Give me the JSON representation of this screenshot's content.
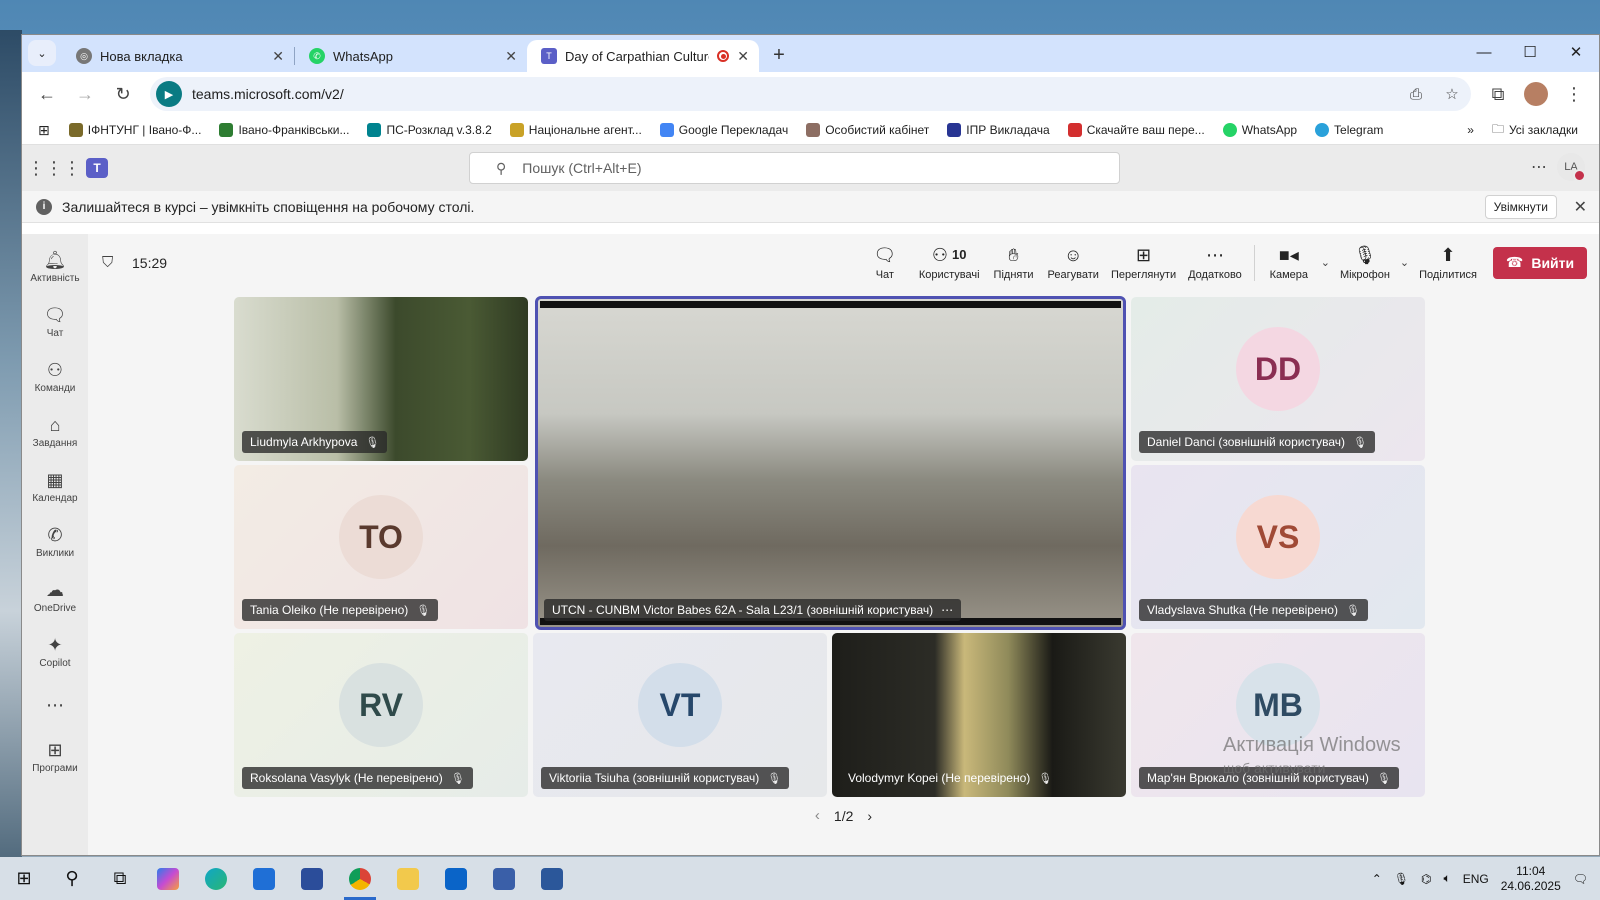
{
  "browser": {
    "tabs": [
      {
        "title": "Нова вкладка",
        "favicon": "chrome-icon",
        "color": "#555555"
      },
      {
        "title": "WhatsApp",
        "favicon": "whatsapp-icon",
        "color": "#25d366"
      },
      {
        "title": "Day of Carpathian Culture (",
        "favicon": "teams-icon",
        "color": "#5b5fc7",
        "active": true
      }
    ],
    "url": "teams.microsoft.com/v2/",
    "bookmarks": [
      {
        "label": "ІФНТУНГ | Івано-Ф...",
        "color": "#7a6a2a"
      },
      {
        "label": "Івано-Франківськи...",
        "color": "#2e7d32"
      },
      {
        "label": "ПС-Розклад v.3.8.2",
        "color": "#00838f"
      },
      {
        "label": "Національне агент...",
        "color": "#c9a227"
      },
      {
        "label": "Google Перекладач",
        "color": "#4285f4"
      },
      {
        "label": "Особистий кабінет",
        "color": "#8d6e63"
      },
      {
        "label": "ІПР Викладача",
        "color": "#283593"
      },
      {
        "label": "Скачайте ваш пере...",
        "color": "#d32f2f"
      },
      {
        "label": "WhatsApp",
        "color": "#25d366"
      },
      {
        "label": "Telegram",
        "color": "#2aa1da"
      }
    ],
    "all_bookmarks": "Усі закладки"
  },
  "teams": {
    "search_placeholder": "Пошук (Ctrl+Alt+E)",
    "me_initials": "LA",
    "notice": {
      "text": "Залишайтеся в курсі – увімкніть сповіщення на робочому столі.",
      "button": "Увімкнути"
    },
    "rail": [
      {
        "label": "Активність",
        "icon": "bell-icon",
        "glyph": "🔔"
      },
      {
        "label": "Чат",
        "icon": "chat-icon",
        "glyph": "💬"
      },
      {
        "label": "Команди",
        "icon": "teams-group-icon",
        "glyph": "👥"
      },
      {
        "label": "Завдання",
        "icon": "tasks-icon",
        "glyph": "📋"
      },
      {
        "label": "Календар",
        "icon": "calendar-icon",
        "glyph": "📅"
      },
      {
        "label": "Виклики",
        "icon": "phone-icon",
        "glyph": "📞"
      },
      {
        "label": "OneDrive",
        "icon": "cloud-icon",
        "glyph": "☁"
      },
      {
        "label": "Copilot",
        "icon": "copilot-icon",
        "glyph": "✦"
      }
    ],
    "rail_apps": {
      "label": "Програми",
      "glyph": "⊞"
    },
    "meeting": {
      "time": "15:29",
      "controls": [
        {
          "label": "Чат",
          "icon": "chat-icon",
          "glyph": "💬"
        },
        {
          "label": "Користувачі",
          "icon": "people-icon",
          "glyph": "👤",
          "count": "10"
        },
        {
          "label": "Підняти",
          "icon": "raise-hand-icon",
          "glyph": "✋"
        },
        {
          "label": "Реагувати",
          "icon": "react-icon",
          "glyph": "☺"
        },
        {
          "label": "Переглянути",
          "icon": "view-icon",
          "glyph": "⊞"
        },
        {
          "label": "Додатково",
          "icon": "more-icon",
          "glyph": "⋯"
        }
      ],
      "camera": "Камера",
      "mic": "Мікрофон",
      "share": "Поділитися",
      "leave": "Вийти",
      "pager": "1/2"
    },
    "tiles": [
      {
        "name": "Liudmyla Arkhypova",
        "initials": "",
        "video": true,
        "bg": "#3b4a2c"
      },
      {
        "name": "UTCN - CUNBM Victor Babes 62A - Sala L23/1 (зовнішній користувач)",
        "initials": "",
        "video": true,
        "bg": "#8a8a86",
        "active": true
      },
      {
        "name": "Daniel Danci (зовнішній користувач)",
        "initials": "DD",
        "video": false,
        "bg": "#eae6ef",
        "circle": "#f4d7e2",
        "color": "#8a2e52"
      },
      {
        "name": "Tania Oleiko (Не перевірено)",
        "initials": "TO",
        "video": false,
        "bg": "#f1e6e2",
        "circle": "#ecdcd6",
        "color": "#5a3a2e"
      },
      {
        "name": "Vladyslava Shutka (Не перевірено)",
        "initials": "VS",
        "video": false,
        "bg": "#e8e8ef",
        "circle": "#f7d9d2",
        "color": "#a04a36"
      },
      {
        "name": "Roksolana Vasylyk (Не перевірено)",
        "initials": "RV",
        "video": false,
        "bg": "#e8ece6",
        "circle": "#d9e1e0",
        "color": "#2f4a4a"
      },
      {
        "name": "Viktoriia Tsiuha (зовнішній користувач)",
        "initials": "VT",
        "video": false,
        "bg": "#e6e8ef",
        "circle": "#d3deea",
        "color": "#26476b"
      },
      {
        "name": "Volodymyr Kopei (Не перевірено)",
        "initials": "",
        "video": true,
        "bg": "#2a2a22"
      },
      {
        "name": "Мар'ян Врюкало (зовнішній користувач)",
        "initials": "MB",
        "video": false,
        "bg": "#ece6ee",
        "circle": "#d8e2ea",
        "color": "#2f4b63"
      }
    ],
    "watermark_title": "Активація Windows",
    "watermark_sub": "щоб активувати"
  },
  "taskbar": {
    "lang": "ENG",
    "time": "11:04",
    "date": "24.06.2025"
  }
}
